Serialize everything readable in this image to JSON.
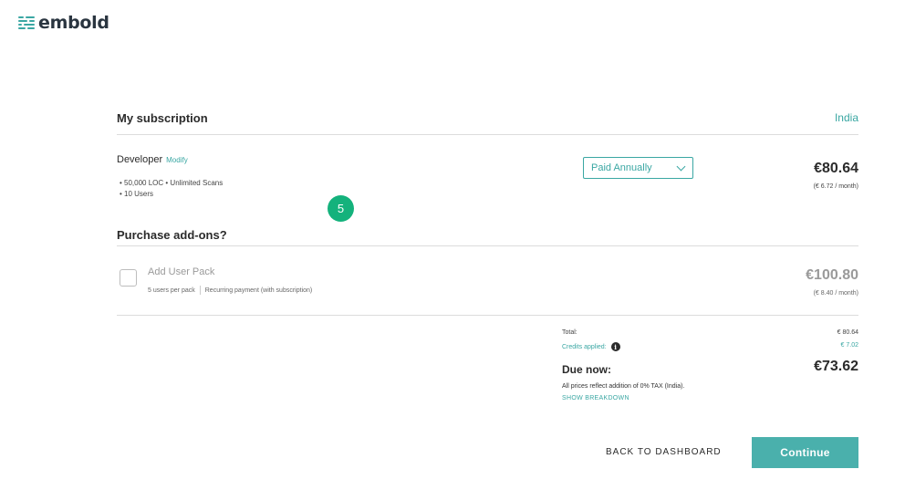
{
  "brand": {
    "name": "embold",
    "accent": "#3aa7a3"
  },
  "subscription": {
    "title": "My subscription",
    "country": "India",
    "plan": {
      "name": "Developer",
      "modify_label": "Modify",
      "features": [
        "• 50,000 LOC • Unlimited Scans",
        "• 10 Users"
      ]
    },
    "billing_select": {
      "selected": "Paid Annually",
      "icon": "chevron-down-icon"
    },
    "price": "€80.64",
    "price_monthly": "(€ 6.72 / month)"
  },
  "step_badge": "5",
  "addons": {
    "title": "Purchase add-ons?",
    "items": [
      {
        "name": "Add User Pack",
        "per_pack": "5 users per pack",
        "payment": "Recurring payment (with subscription)",
        "price": "€100.80",
        "price_monthly": "(€ 8.40 / month)",
        "checked": false
      }
    ]
  },
  "summary": {
    "total_label": "Total:",
    "total_value": "€ 80.64",
    "credits_label": "Credits applied:",
    "credits_value": "€ 7.02",
    "info_icon": "i",
    "due_label": "Due now:",
    "due_value": "€73.62",
    "tax_note": "All prices reflect addition of 0% TAX (India).",
    "breakdown_link": "SHOW BREAKDOWN"
  },
  "actions": {
    "back_label": "BACK TO DASHBOARD",
    "continue_label": "Continue"
  }
}
